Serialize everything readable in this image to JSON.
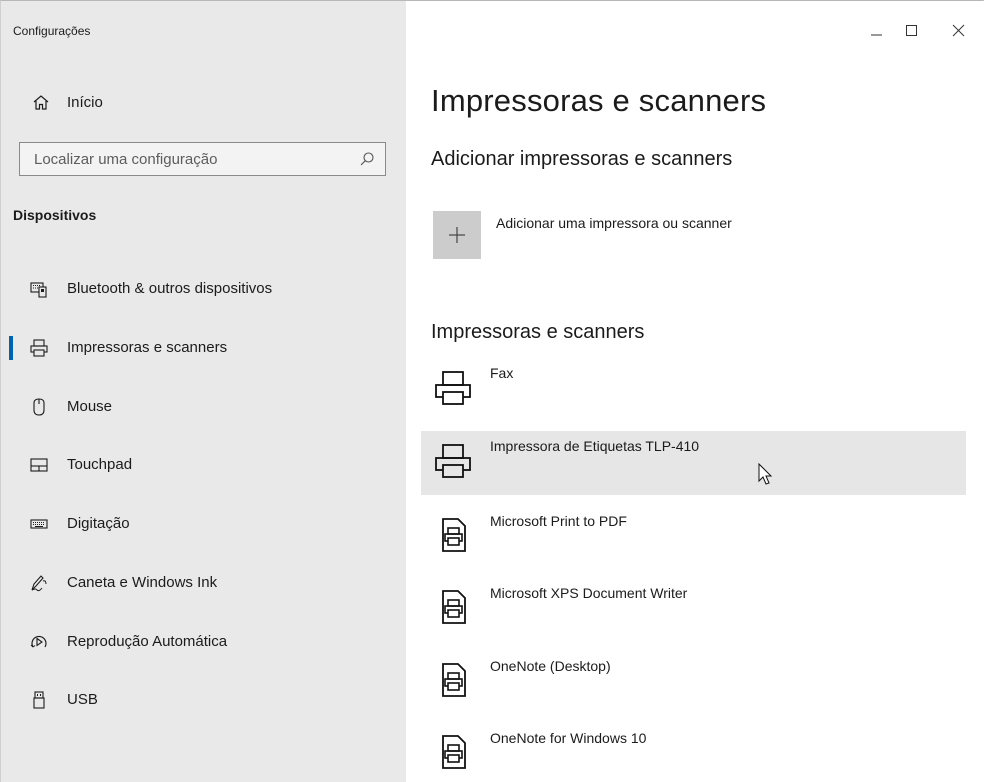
{
  "window": {
    "title": "Configurações",
    "controls": {
      "minimize": "—",
      "maximize": "☐",
      "close": "✕"
    }
  },
  "sidebar": {
    "home": {
      "label": "Início",
      "icon": "home-icon"
    },
    "search": {
      "placeholder": "Localizar uma configuração",
      "value": "",
      "icon": "search-icon"
    },
    "section_title": "Dispositivos",
    "items": [
      {
        "label": "Bluetooth & outros dispositivos",
        "icon": "bluetooth-devices-icon",
        "active": false
      },
      {
        "label": "Impressoras e scanners",
        "icon": "printer-icon",
        "active": true
      },
      {
        "label": "Mouse",
        "icon": "mouse-icon",
        "active": false
      },
      {
        "label": "Touchpad",
        "icon": "touchpad-icon",
        "active": false
      },
      {
        "label": "Digitação",
        "icon": "keyboard-icon",
        "active": false
      },
      {
        "label": "Caneta e Windows Ink",
        "icon": "pen-icon",
        "active": false
      },
      {
        "label": "Reprodução Automática",
        "icon": "autoplay-icon",
        "active": false
      },
      {
        "label": "USB",
        "icon": "usb-icon",
        "active": false
      }
    ]
  },
  "main": {
    "title": "Impressoras e scanners",
    "add_section": {
      "title": "Adicionar impressoras e scanners",
      "button_label": "Adicionar uma impressora ou scanner"
    },
    "list_title": "Impressoras e scanners",
    "printers": [
      {
        "name": "Fax",
        "icon": "printer-icon",
        "hovered": false
      },
      {
        "name": "Impressora de Etiquetas TLP-410",
        "icon": "printer-icon",
        "hovered": true
      },
      {
        "name": "Microsoft Print to PDF",
        "icon": "document-printer-icon",
        "hovered": false
      },
      {
        "name": "Microsoft XPS Document Writer",
        "icon": "document-printer-icon",
        "hovered": false
      },
      {
        "name": "OneNote (Desktop)",
        "icon": "document-printer-icon",
        "hovered": false
      },
      {
        "name": "OneNote for Windows 10",
        "icon": "document-printer-icon",
        "hovered": false
      }
    ]
  },
  "colors": {
    "sidebar_bg": "#e9e9e9",
    "accent": "#0063b1",
    "hover_bg": "#e6e6e6",
    "tile_bg": "#cccccc"
  }
}
